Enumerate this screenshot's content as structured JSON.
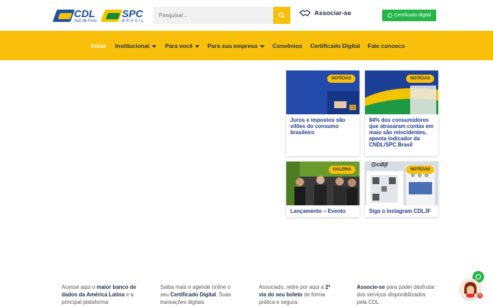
{
  "header": {
    "cdl_logo": {
      "name": "CDL",
      "sub": "Juiz de Fora"
    },
    "spc_logo": {
      "name": "SPC",
      "sub": "BRASIL"
    },
    "search": {
      "placeholder": "Pesquisar..."
    },
    "associar_label": "Associar-se",
    "cert_button_label": "Certificado digital"
  },
  "nav": {
    "items": [
      {
        "label": "Início",
        "active": true
      },
      {
        "label": "Institucional",
        "dropdown": true
      },
      {
        "label": "Para você",
        "dropdown": true
      },
      {
        "label": "Para sua empresa",
        "dropdown": true
      },
      {
        "label": "Convênios"
      },
      {
        "label": "Certificado Digital"
      },
      {
        "label": "Fale conosco"
      }
    ]
  },
  "cards": [
    {
      "badge": "NOTÍCIAS",
      "title": "Juros e impostos são vilões do consumo brasileiro"
    },
    {
      "badge": "NOTÍCIAS",
      "title": "84% dos consumidores que atrasaram contas em maio são reincidentes, aponta indicador da CNDL/SPC Brasil"
    },
    {
      "badge": "GALERIA",
      "title": "Lançamento – Evento"
    },
    {
      "badge": "NOTÍCIAS",
      "title": "Siga o instagram CDLJF",
      "image_text": "@cdljf"
    }
  ],
  "columns": [
    {
      "pre": "Acesse aqui o ",
      "bold": "maior banco de dados da América Latina",
      "post": " e a principal plataforma"
    },
    {
      "pre": "Saiba mais e agende online o seu ",
      "bold": "Certificado Digital",
      "post": ". Suas transações digitais"
    },
    {
      "pre": "Associado, retire por aqui a ",
      "bold": "2ª via do seu boleto",
      "post": " de forma prática e segura."
    },
    {
      "pre": "",
      "bold": "Associe-se",
      "post": " para poder desfrutar dos serviços disponibilizados pela CDL"
    }
  ],
  "chat": {
    "badge_count": "1"
  },
  "colors": {
    "yellow": "#f8bf0b",
    "navy": "#1f2a44",
    "blue": "#1e3a8a",
    "green": "#25b548"
  },
  "icons": [
    "search-icon",
    "handshake-icon",
    "whatsapp-icon",
    "chevron-down-icon"
  ]
}
